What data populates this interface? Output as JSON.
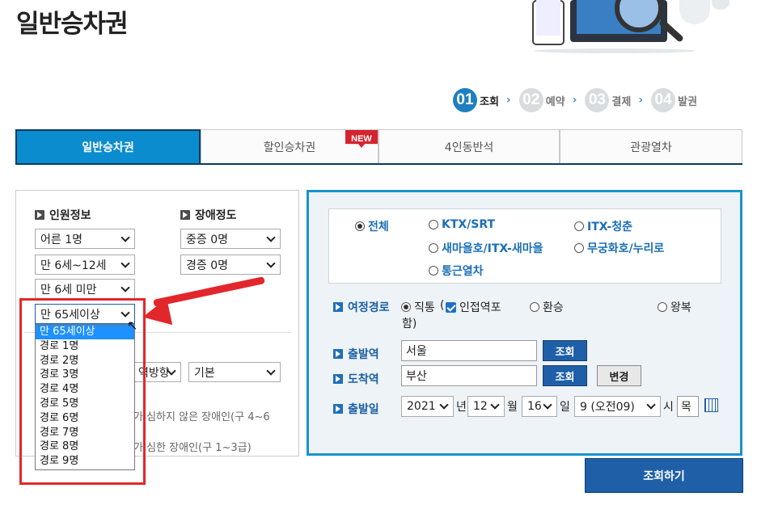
{
  "page": {
    "title": "일반승차권"
  },
  "steps": [
    {
      "num": "01",
      "label": "조회",
      "active": true
    },
    {
      "num": "02",
      "label": "예약",
      "active": false
    },
    {
      "num": "03",
      "label": "결제",
      "active": false
    },
    {
      "num": "04",
      "label": "발권",
      "active": false
    }
  ],
  "tabs": [
    "일반승차권",
    "할인승차권",
    "4인동반석",
    "관광열차"
  ],
  "new_badge": "NEW",
  "passengers": {
    "section_label": "인원정보",
    "adult": "어른 1명",
    "child": "만 6세~12세",
    "infant": "만 6세 미만",
    "senior": "만 65세이상"
  },
  "disability": {
    "section_label": "장애정도",
    "severe": "중증 0명",
    "mild": "경증 0명"
  },
  "senior_options": [
    "만 65세이상",
    "경로 1명",
    "경로 2명",
    "경로 3명",
    "경로 4명",
    "경로 5명",
    "경로 6명",
    "경로 7명",
    "경로 8명",
    "경로 9명"
  ],
  "seat": {
    "direction_partial": "역방향",
    "type": "기본"
  },
  "notes": {
    "mild_partial": "가 심하지 않은 장애인(구 4~6",
    "severe_partial": "가 심한 장애인(구 1~3급)"
  },
  "train_types": [
    {
      "label": "전체",
      "checked": true
    },
    {
      "label": "KTX/SRT",
      "checked": false
    },
    {
      "label": "ITX-청춘",
      "checked": false
    },
    {
      "label": "새마을호/ITX-새마을",
      "checked": false
    },
    {
      "label": "무궁화호/누리로",
      "checked": false
    },
    {
      "label": "통근열차",
      "checked": false
    }
  ],
  "route": {
    "label": "여정경로",
    "direct": "직통",
    "nearby_a": "인접역포",
    "nearby_b": "함)",
    "transfer": "환승",
    "roundtrip": "왕복",
    "open_paren": "("
  },
  "departure": {
    "label": "출발역",
    "value": "서울",
    "button": "조회"
  },
  "arrival": {
    "label": "도착역",
    "value": "부산",
    "button": "조회",
    "change_button": "변경"
  },
  "date": {
    "label": "출발일",
    "year": "2021",
    "year_unit": "년",
    "month": "12",
    "month_unit": "월",
    "day": "16",
    "day_unit": "일",
    "hour": "9 (오전09)",
    "hour_unit": "시",
    "weekday": "목"
  },
  "search_button": "조회하기"
}
